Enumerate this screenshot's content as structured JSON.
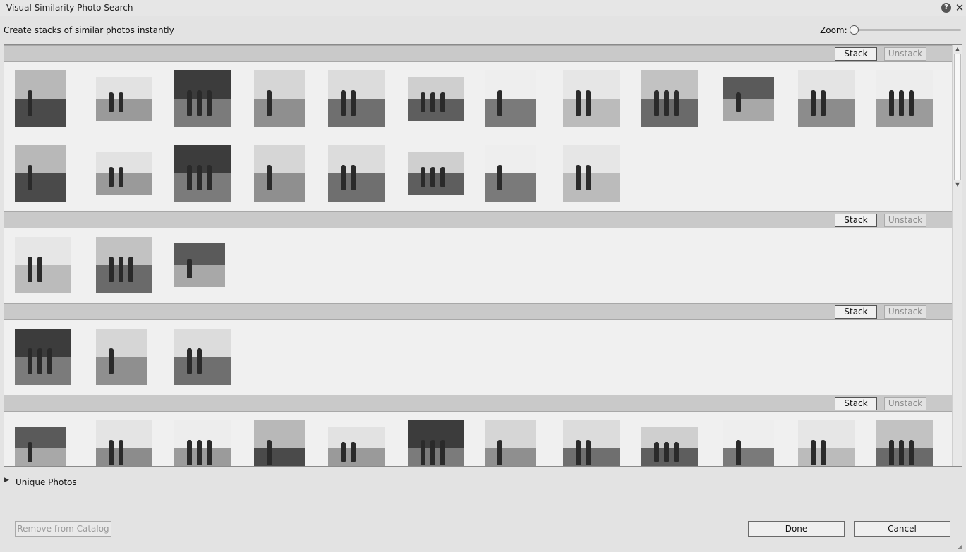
{
  "window": {
    "title": "Visual Similarity Photo Search",
    "help_glyph": "?",
    "close_glyph": "✕"
  },
  "header": {
    "subtitle": "Create stacks of similar photos instantly",
    "zoom_label": "Zoom:",
    "zoom_level": 0
  },
  "groups": [
    {
      "stack_label": "Stack",
      "unstack_label": "Unstack",
      "photo_count": 20
    },
    {
      "stack_label": "Stack",
      "unstack_label": "Unstack",
      "photo_count": 3
    },
    {
      "stack_label": "Stack",
      "unstack_label": "Unstack",
      "photo_count": 3
    },
    {
      "stack_label": "Stack",
      "unstack_label": "Unstack",
      "photo_count": 12
    }
  ],
  "unique": {
    "label": "Unique Photos",
    "arrow": "▶"
  },
  "footer": {
    "remove_label": "Remove from Catalog",
    "done_label": "Done",
    "cancel_label": "Cancel"
  },
  "colors": {
    "header_bar": "#c9c9c9",
    "panel_bg": "#f0f0f0",
    "photo_dark": "#3a3a3a",
    "photo_mid": "#8a8a8a",
    "photo_light": "#cfcfcf"
  }
}
